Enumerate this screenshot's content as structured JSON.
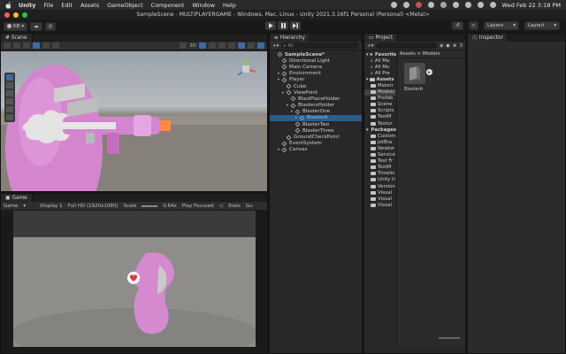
{
  "macbar": {
    "app_name": "Unity",
    "menu": [
      "File",
      "Edit",
      "Assets",
      "GameObject",
      "Component",
      "Window",
      "Help"
    ],
    "clock": "Wed Feb 22  3:18 PM"
  },
  "title": "SampleScene - MULTIPLAYERGAME - Windows, Mac, Linux - Unity 2021.3.16f1 Personal (Personal) <Metal>",
  "toolbar": {
    "account_label": "KB",
    "layers_label": "Layers",
    "layout_label": "Layout"
  },
  "scene_panel": {
    "tab_label": "Scene",
    "twod_label": "2D"
  },
  "game_panel": {
    "tab_label": "Game",
    "game_dropdown": "Game",
    "display": "Display 1",
    "resolution": "Full HD (1920x1080)",
    "scale_label": "Scale",
    "scale_value": "0.64x",
    "play_mode": "Play Focused",
    "stats": "Stats",
    "gizmos": "Gu"
  },
  "hierarchy": {
    "tab_label": "Hierarchy",
    "search_placeholder": "All",
    "items": [
      {
        "label": "SampleScene*",
        "indent": 0,
        "type": "scene"
      },
      {
        "label": "Directional Light",
        "indent": 1
      },
      {
        "label": "Main Camera",
        "indent": 1
      },
      {
        "label": "Environment",
        "indent": 1,
        "arrow": true
      },
      {
        "label": "Player",
        "indent": 1,
        "arrow": true
      },
      {
        "label": "Cube",
        "indent": 2
      },
      {
        "label": "ViewPoint",
        "indent": 2,
        "arrow": true
      },
      {
        "label": "BlastPlaceHolder",
        "indent": 3
      },
      {
        "label": "BlastersHolder",
        "indent": 3,
        "arrow": true
      },
      {
        "label": "BlasterOne",
        "indent": 4,
        "arrow": true
      },
      {
        "label": "BlasterA",
        "indent": 5,
        "arrow": true,
        "selected": true
      },
      {
        "label": "BlasterTwo",
        "indent": 4
      },
      {
        "label": "BlasterThree",
        "indent": 4
      },
      {
        "label": "GroundCheckPoint",
        "indent": 2
      },
      {
        "label": "EventSystem",
        "indent": 1
      },
      {
        "label": "Canvas",
        "indent": 1,
        "arrow": true
      }
    ]
  },
  "project": {
    "tab_label": "Project",
    "breadcrumb": "Assets > Models",
    "count": "3",
    "tree": [
      {
        "label": "Favorites",
        "type": "star",
        "indent": 0
      },
      {
        "label": "All Ma",
        "indent": 1,
        "type": "search"
      },
      {
        "label": "All Mo",
        "indent": 1,
        "type": "search"
      },
      {
        "label": "All Pre",
        "indent": 1,
        "type": "search"
      },
      {
        "label": "Assets",
        "indent": 0,
        "type": "folder"
      },
      {
        "label": "Materi",
        "indent": 1,
        "type": "folder"
      },
      {
        "label": "Models",
        "indent": 1,
        "type": "folder",
        "selected": true
      },
      {
        "label": "Prefab",
        "indent": 1,
        "type": "folder"
      },
      {
        "label": "Scene",
        "indent": 1,
        "type": "folder"
      },
      {
        "label": "Scripts",
        "indent": 1,
        "type": "folder"
      },
      {
        "label": "TextM",
        "indent": 1,
        "type": "folder"
      },
      {
        "label": "Textur",
        "indent": 1,
        "type": "folder"
      },
      {
        "label": "Packages",
        "indent": 0,
        "type": "folder"
      },
      {
        "label": "Custom",
        "indent": 1,
        "type": "folder"
      },
      {
        "label": "JetBra",
        "indent": 1,
        "type": "folder"
      },
      {
        "label": "Newtor",
        "indent": 1,
        "type": "folder"
      },
      {
        "label": "Service",
        "indent": 1,
        "type": "folder"
      },
      {
        "label": "Test Fr",
        "indent": 1,
        "type": "folder"
      },
      {
        "label": "TextM",
        "indent": 1,
        "type": "folder"
      },
      {
        "label": "Timelin",
        "indent": 1,
        "type": "folder"
      },
      {
        "label": "Unity U",
        "indent": 1,
        "type": "folder"
      },
      {
        "label": "Version",
        "indent": 1,
        "type": "folder"
      },
      {
        "label": "Visual",
        "indent": 1,
        "type": "folder"
      },
      {
        "label": "Visual",
        "indent": 1,
        "type": "folder"
      },
      {
        "label": "Visual",
        "indent": 1,
        "type": "folder"
      }
    ],
    "asset_name": "BlasterA"
  },
  "inspector": {
    "tab_label": "Inspector"
  },
  "colors": {
    "accent": "#3d6aa6",
    "selection": "#2c5d87",
    "pink": "#d67fd1"
  }
}
